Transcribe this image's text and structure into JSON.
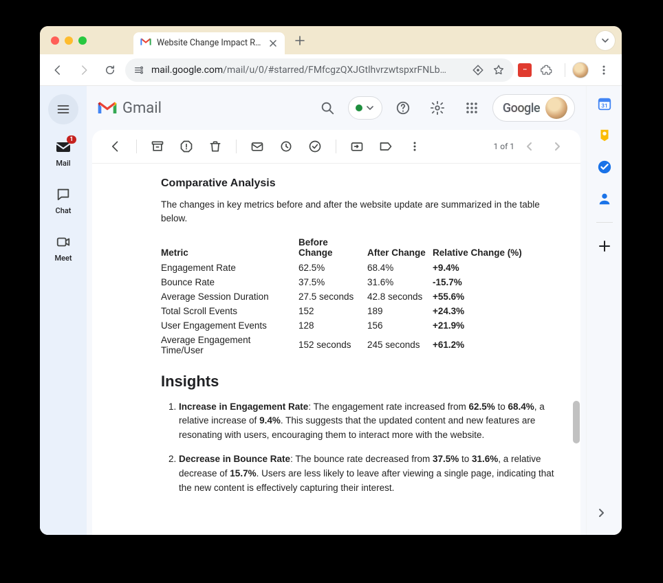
{
  "browser": {
    "tab_title": "Website Change Impact Repo",
    "url_host": "mail.google.com",
    "url_path": "/mail/u/0/#starred/FMfcgzQXJGtlhvrzwtspxrFNLb…"
  },
  "gmail": {
    "product_name": "Gmail",
    "google_label": "Google"
  },
  "leftnav": {
    "mail": "Mail",
    "mail_badge": "1",
    "chat": "Chat",
    "meet": "Meet"
  },
  "mail_toolbar": {
    "pager": "1 of 1"
  },
  "content": {
    "section_title": "Comparative Analysis",
    "intro": "The changes in key metrics before and after the website update are summarized in the table below.",
    "table": {
      "headers": {
        "metric": "Metric",
        "before": "Before Change",
        "after": "After Change",
        "relative": "Relative Change (%)"
      },
      "rows": [
        {
          "metric": "Engagement Rate",
          "before": "62.5%",
          "after": "68.4%",
          "relative": "+9.4%"
        },
        {
          "metric": "Bounce Rate",
          "before": "37.5%",
          "after": "31.6%",
          "relative": "-15.7%"
        },
        {
          "metric": "Average Session Duration",
          "before": "27.5 seconds",
          "after": "42.8 seconds",
          "relative": "+55.6%"
        },
        {
          "metric": "Total Scroll Events",
          "before": "152",
          "after": "189",
          "relative": "+24.3%"
        },
        {
          "metric": "User Engagement Events",
          "before": "128",
          "after": "156",
          "relative": "+21.9%"
        },
        {
          "metric": "Average Engagement Time/User",
          "before": "152 seconds",
          "after": "245 seconds",
          "relative": "+61.2%"
        }
      ]
    },
    "insights_title": "Insights",
    "insights": [
      {
        "lead": "Increase in Engagement Rate",
        "t1": ": The engagement rate increased from ",
        "b1": "62.5%",
        "t2": " to ",
        "b2": "68.4%",
        "t3": ", a relative increase of ",
        "b3": "9.4%",
        "t4": ". This suggests that the updated content and new features are resonating with users, encouraging them to interact more with the website."
      },
      {
        "lead": "Decrease in Bounce Rate",
        "t1": ": The bounce rate decreased from ",
        "b1": "37.5%",
        "t2": " to ",
        "b2": "31.6%",
        "t3": ", a relative decrease of ",
        "b3": "15.7%",
        "t4": ". Users are less likely to leave after viewing a single page, indicating that the new content is effectively capturing their interest."
      }
    ]
  }
}
